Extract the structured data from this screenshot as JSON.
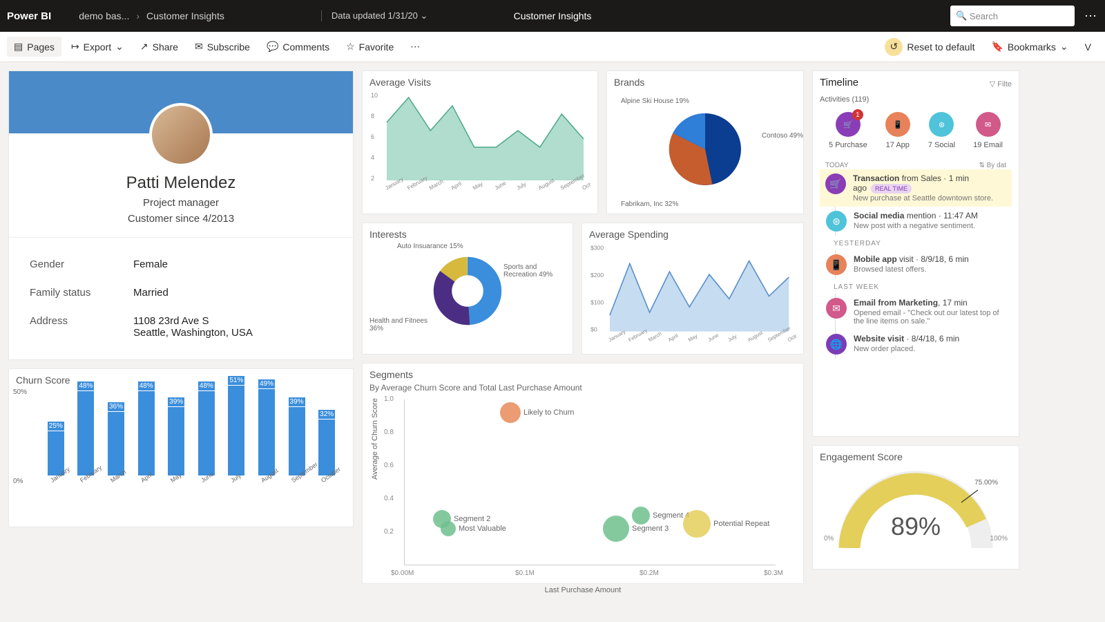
{
  "top": {
    "brand": "Power BI",
    "crumb1": "demo bas...",
    "crumb2": "Customer Insights",
    "center_title": "Customer Insights",
    "updated": "Data updated 1/31/20",
    "search_placeholder": "Search"
  },
  "cmd": {
    "pages": "Pages",
    "export": "Export",
    "share": "Share",
    "subscribe": "Subscribe",
    "comments": "Comments",
    "favorite": "Favorite",
    "reset": "Reset to default",
    "bookmarks": "Bookmarks",
    "view": "V"
  },
  "profile": {
    "name": "Patti Melendez",
    "role": "Project manager",
    "since": "Customer since 4/2013",
    "gender_lbl": "Gender",
    "gender_val": "Female",
    "family_lbl": "Family status",
    "family_val": "Married",
    "address_lbl": "Address",
    "address_line1": "1108 23rd Ave S",
    "address_line2": "Seattle, Washington, USA"
  },
  "churn": {
    "title": "Churn Score"
  },
  "avg_visits": {
    "title": "Average Visits"
  },
  "interests": {
    "title": "Interests",
    "s1": "Auto Insuarance 15%",
    "s2": "Sports and Recreation 49%",
    "s3": "Health and Fitnees 36%"
  },
  "brands": {
    "title": "Brands",
    "s1": "Alpine Ski House 19%",
    "s2": "Contoso 49%",
    "s3": "Fabrikam, Inc 32%"
  },
  "avg_spend": {
    "title": "Average Spending"
  },
  "segments": {
    "title": "Segments",
    "subtitle": "By Average Churn Score and Total Last Purchase Amount",
    "xlabel": "Last Purchase Amount",
    "ylabel": "Average of Churn Score",
    "p1": "Likely to Churn",
    "p2": "Segment 2",
    "p3": "Most Valuable",
    "p4": "Segment 3",
    "p5": "Segment 4",
    "p6": "Potential Repeat"
  },
  "timeline": {
    "title": "Timeline",
    "filter": "Filte",
    "activities_lbl": "Activities (119)",
    "bydate": "By dat",
    "a1": "5 Purchase",
    "a2": "17 App",
    "a3": "7 Social",
    "a4": "19 Email",
    "today": "TODAY",
    "yesterday": "YESTERDAY",
    "lastweek": "LAST WEEK",
    "i1_t": "Transaction",
    "i1_s": " from Sales · 1 min ago",
    "i1_d": "New purchase at Seattle downtown store.",
    "i1_b": "REAL TIME",
    "i2_t": "Social media",
    "i2_s": " mention · 11:47 AM",
    "i2_d": "New post with a negative sentiment.",
    "i3_t": "Mobile app",
    "i3_s": " visit · 8/9/18, 6 min",
    "i3_d": "Browsed latest offers.",
    "i4_t": "Email from Marketing",
    "i4_s": ", 17 min",
    "i4_d": "Opened email - \"Check out our latest top of the line items on sale.\"",
    "i5_t": "Website visit",
    "i5_s": " · 8/4/18, 6 min",
    "i5_d": "New order placed."
  },
  "engagement": {
    "title": "Engagement Score",
    "value": "89%",
    "left": "0%",
    "right": "100%",
    "mark": "75.00%"
  },
  "chart_data": [
    {
      "type": "bar",
      "name": "Churn Score",
      "categories": [
        "January",
        "February",
        "March",
        "April",
        "May",
        "June",
        "July",
        "August",
        "September",
        "October"
      ],
      "values": [
        25,
        48,
        36,
        48,
        39,
        48,
        51,
        49,
        39,
        32
      ],
      "ylabel": "",
      "ylim": [
        0,
        50
      ],
      "yticks": [
        "0%",
        "50%"
      ]
    },
    {
      "type": "area",
      "name": "Average Visits",
      "x": [
        "January",
        "February",
        "March",
        "April",
        "May",
        "June",
        "July",
        "August",
        "September",
        "October"
      ],
      "values": [
        7,
        10,
        6,
        9,
        4,
        4,
        6,
        4,
        8,
        5
      ],
      "ylim": [
        0,
        10
      ],
      "yticks": [
        2,
        4,
        6,
        8,
        10
      ]
    },
    {
      "type": "pie",
      "name": "Interests",
      "series": [
        {
          "name": "Sports and Recreation",
          "value": 49,
          "color": "#3b8edb"
        },
        {
          "name": "Health and Fitnees",
          "value": 36,
          "color": "#4b2e83"
        },
        {
          "name": "Auto Insuarance",
          "value": 15,
          "color": "#d6b93d"
        }
      ],
      "donut": true
    },
    {
      "type": "pie",
      "name": "Brands",
      "series": [
        {
          "name": "Contoso",
          "value": 49,
          "color": "#0b3d91"
        },
        {
          "name": "Fabrikam, Inc",
          "value": 32,
          "color": "#c65d2e"
        },
        {
          "name": "Alpine Ski House",
          "value": 19,
          "color": "#2f7ed8"
        }
      ]
    },
    {
      "type": "area",
      "name": "Average Spending",
      "x": [
        "January",
        "February",
        "March",
        "April",
        "May",
        "June",
        "July",
        "August",
        "September",
        "October"
      ],
      "values": [
        60,
        250,
        70,
        220,
        90,
        210,
        120,
        260,
        130,
        200
      ],
      "ylim": [
        0,
        300
      ],
      "yticks": [
        "$0",
        "$100",
        "$200",
        "$300"
      ]
    },
    {
      "type": "scatter",
      "name": "Segments",
      "xlabel": "Last Purchase Amount",
      "ylabel": "Average of Churn Score",
      "xlim": [
        0,
        0.3
      ],
      "ylim": [
        0,
        1
      ],
      "xticks": [
        "$0.00M",
        "$0.1M",
        "$0.2M",
        "$0.3M"
      ],
      "yticks": [
        0.2,
        0.4,
        0.6,
        0.8,
        1.0
      ],
      "points": [
        {
          "name": "Likely to Churn",
          "x": 0.085,
          "y": 0.92,
          "size": 30,
          "color": "#e78b5a"
        },
        {
          "name": "Segment 2",
          "x": 0.03,
          "y": 0.28,
          "size": 26,
          "color": "#6fbf8d"
        },
        {
          "name": "Most Valuable",
          "x": 0.035,
          "y": 0.22,
          "size": 22,
          "color": "#6fbf8d"
        },
        {
          "name": "Segment 3",
          "x": 0.17,
          "y": 0.22,
          "size": 38,
          "color": "#6fbf8d"
        },
        {
          "name": "Segment 4",
          "x": 0.19,
          "y": 0.3,
          "size": 26,
          "color": "#6fbf8d"
        },
        {
          "name": "Potential Repeat",
          "x": 0.235,
          "y": 0.25,
          "size": 40,
          "color": "#e3cf5a"
        }
      ]
    },
    {
      "type": "gauge",
      "name": "Engagement Score",
      "value": 89,
      "min": 0,
      "max": 100,
      "mark": 75
    }
  ]
}
